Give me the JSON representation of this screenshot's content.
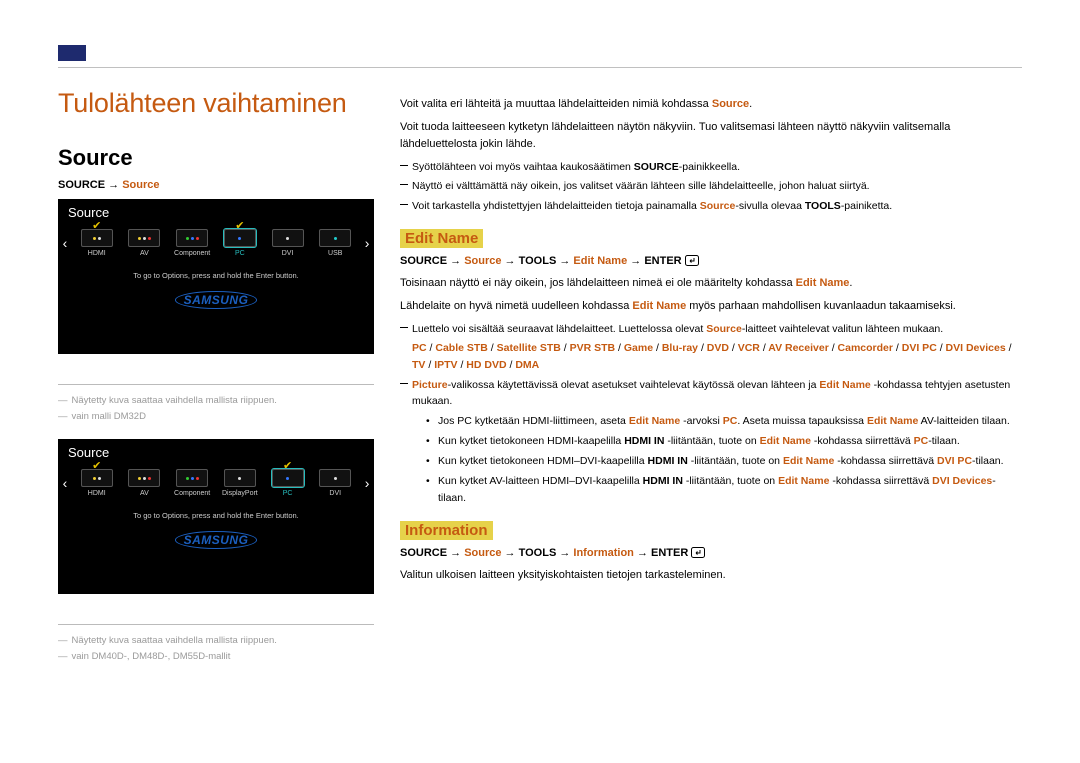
{
  "chapter_title": "Tulolähteen vaihtaminen",
  "section_title": "Source",
  "path1_a": "SOURCE → ",
  "path1_b": "Source",
  "tv": {
    "title": "Source",
    "hint": "To go to Options, press and hold the Enter button.",
    "logo": "SAMSUNG"
  },
  "tv1_items": [
    "HDMI",
    "AV",
    "Component",
    "PC",
    "DVI",
    "USB"
  ],
  "tv2_items": [
    "HDMI",
    "AV",
    "Component",
    "DisplayPort",
    "PC",
    "DVI"
  ],
  "caption1a": "Näytetty kuva saattaa vaihdella mallista riippuen.",
  "caption1b": "vain malli DM32D",
  "caption2a": "Näytetty kuva saattaa vaihdella mallista riippuen.",
  "caption2b": "vain DM40D-, DM48D-, DM55D-mallit",
  "r_p1a": "Voit valita eri lähteitä ja muuttaa lähdelaitteiden nimiä kohdassa ",
  "r_p1b": "Source",
  "r_p1c": ".",
  "r_p2": "Voit tuoda laitteeseen kytketyn lähdelaitteen näytön näkyviin. Tuo valitsemasi lähteen näyttö näkyviin valitsemalla lähdeluettelosta jokin lähde.",
  "r_n1a": "Syöttölähteen voi myös vaihtaa kaukosäätimen ",
  "r_n1b": "SOURCE",
  "r_n1c": "-painikkeella.",
  "r_n2": "Näyttö ei välttämättä näy oikein, jos valitset väärän lähteen sille lähdelaitteelle, johon haluat siirtyä.",
  "r_n3a": "Voit tarkastella yhdistettyjen lähdelaitteiden tietoja painamalla ",
  "r_n3b": "Source",
  "r_n3c": "-sivulla olevaa ",
  "r_n3d": "TOOLS",
  "r_n3e": "-painiketta.",
  "edit_name": "Edit Name",
  "path2_a": "SOURCE → ",
  "path2_b": "Source",
  "path2_c": " → TOOLS → ",
  "path2_d": "Edit Name",
  "path2_e": " → ENTER ",
  "e_p1a": "Toisinaan näyttö ei näy oikein, jos lähdelaitteen nimeä ei ole määritelty kohdassa ",
  "e_p1b": "Edit Name",
  "e_p1c": ".",
  "e_p2a": "Lähdelaite on hyvä nimetä uudelleen kohdassa ",
  "e_p2b": "Edit Name",
  "e_p2c": " myös parhaan mahdollisen kuvanlaadun takaamiseksi.",
  "e_n1a": "Luettelo voi sisältää seuraavat lähdelaitteet. Luettelossa olevat ",
  "e_n1b": "Source",
  "e_n1c": "-laitteet vaihtelevat valitun lähteen mukaan.",
  "devices": "PC / Cable STB / Satellite STB / PVR STB / Game / Blu-ray / DVD / VCR / AV Receiver / Camcorder / DVI PC / DVI Devices / TV / IPTV / HD DVD / DMA",
  "e_n2a": "Picture",
  "e_n2b": "-valikossa käytettävissä olevat asetukset vaihtelevat käytössä olevan lähteen ja ",
  "e_n2c": "Edit Name",
  "e_n2d": " -kohdassa tehtyjen asetusten mukaan.",
  "b1a": "Jos PC kytketään HDMI-liittimeen, aseta ",
  "b1b": "Edit Name",
  "b1c": " -arvoksi ",
  "b1d": "PC",
  "b1e": ". Aseta muissa tapauksissa ",
  "b1f": "Edit Name",
  "b1g": " AV-laitteiden tilaan.",
  "b2a": "Kun kytket tietokoneen HDMI-kaapelilla ",
  "b2b": "HDMI IN",
  "b2c": " -liitäntään, tuote on ",
  "b2d": "Edit Name",
  "b2e": " -kohdassa siirrettävä ",
  "b2f": "PC",
  "b2g": "-tilaan.",
  "b3a": "Kun kytket tietokoneen HDMI–DVI-kaapelilla ",
  "b3b": "HDMI IN",
  "b3c": " -liitäntään, tuote on ",
  "b3d": "Edit Name",
  "b3e": " -kohdassa siirrettävä ",
  "b3f": "DVI PC",
  "b3g": "-tilaan.",
  "b4a": "Kun kytket AV-laitteen HDMI–DVI-kaapelilla ",
  "b4b": "HDMI IN",
  "b4c": " -liitäntään, tuote on ",
  "b4d": "Edit Name",
  "b4e": " -kohdassa siirrettävä ",
  "b4f": "DVI Devices",
  "b4g": "-tilaan.",
  "information": "Information",
  "path3_a": "SOURCE → ",
  "path3_b": "Source",
  "path3_c": " → TOOLS → ",
  "path3_d": "Information",
  "path3_e": " → ENTER ",
  "i_p1": "Valitun ulkoisen laitteen yksityiskohtaisten tietojen tarkasteleminen."
}
